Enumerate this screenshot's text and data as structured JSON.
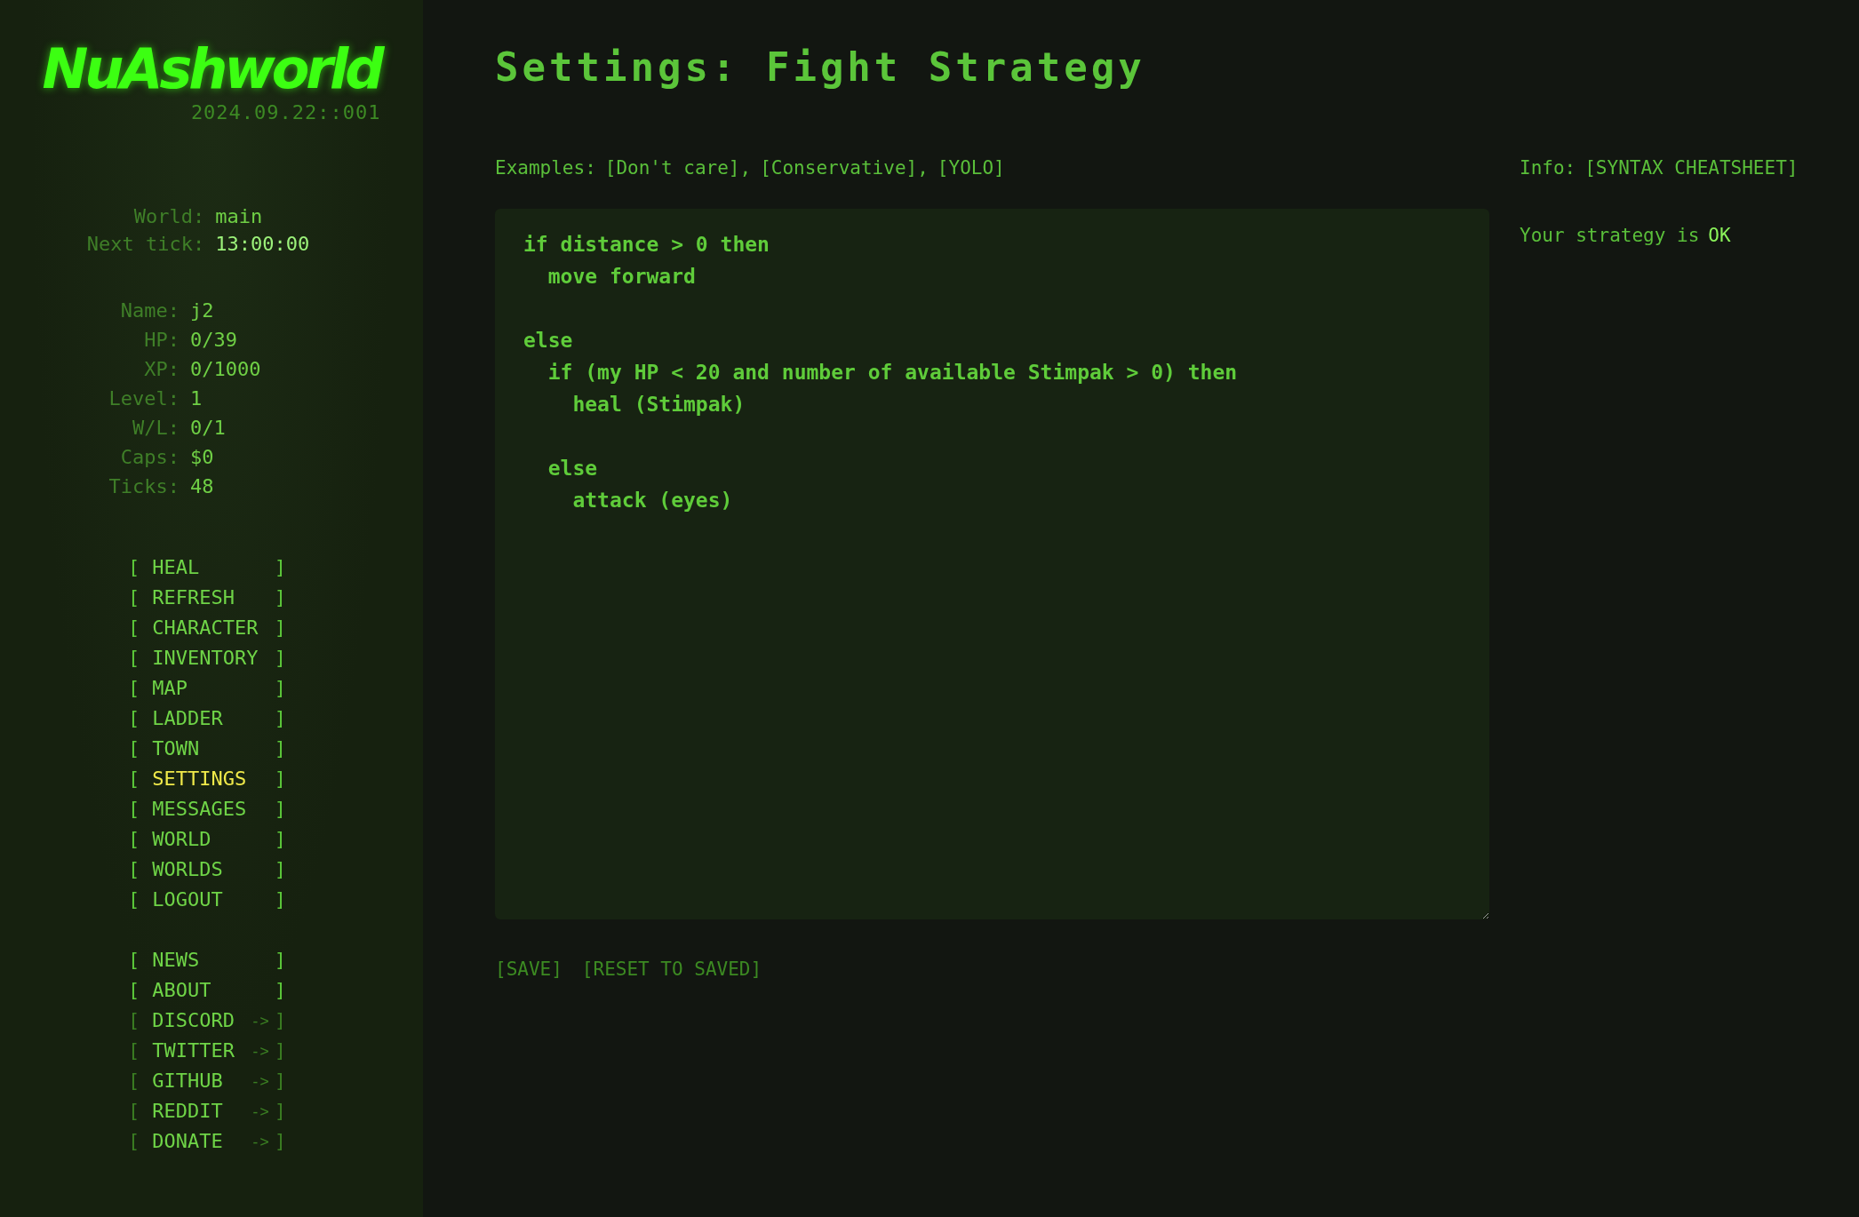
{
  "sidebar": {
    "logo": "NuAshworld",
    "version": "2024.09.22::001",
    "world_info": [
      {
        "label": "World:",
        "value": "main",
        "kind": "plain"
      },
      {
        "label": "Next tick:",
        "value": "13:00:00",
        "kind": "highlight"
      }
    ],
    "stats": [
      {
        "label": "Name:",
        "value": "j2"
      },
      {
        "label": "HP:",
        "value": "0/39"
      },
      {
        "label": "XP:",
        "value": "0/1000"
      },
      {
        "label": "Level:",
        "value": "1"
      },
      {
        "label": "W/L:",
        "value": "0/1"
      },
      {
        "label": "Caps:",
        "value": "$0"
      },
      {
        "label": "Ticks:",
        "value": "48"
      }
    ],
    "menu_groups": [
      [
        {
          "open": "[",
          "label": "HEAL",
          "close": "]",
          "selected": false,
          "kind": "internal"
        },
        {
          "open": "[",
          "label": "REFRESH",
          "close": "]",
          "selected": false,
          "kind": "internal"
        },
        {
          "open": "[",
          "label": "CHARACTER",
          "close": "]",
          "selected": false,
          "kind": "internal"
        },
        {
          "open": "[",
          "label": "INVENTORY",
          "close": "]",
          "selected": false,
          "kind": "internal"
        },
        {
          "open": "[",
          "label": "MAP",
          "close": "]",
          "selected": false,
          "kind": "internal"
        },
        {
          "open": "[",
          "label": "LADDER",
          "close": "]",
          "selected": false,
          "kind": "internal"
        },
        {
          "open": "[",
          "label": "TOWN",
          "close": "]",
          "selected": false,
          "kind": "internal"
        },
        {
          "open": "[",
          "label": "SETTINGS",
          "close": "]",
          "selected": true,
          "kind": "internal"
        },
        {
          "open": "[",
          "label": "MESSAGES",
          "close": "]",
          "selected": false,
          "kind": "internal"
        },
        {
          "open": "[",
          "label": "WORLD",
          "close": "]",
          "selected": false,
          "kind": "internal"
        },
        {
          "open": "[",
          "label": "WORLDS",
          "close": "]",
          "selected": false,
          "kind": "internal"
        },
        {
          "open": "[",
          "label": "LOGOUT",
          "close": "]",
          "selected": false,
          "kind": "internal"
        }
      ],
      [
        {
          "open": "[",
          "label": "NEWS",
          "close": "]",
          "selected": false,
          "kind": "internal"
        },
        {
          "open": "[",
          "label": "ABOUT",
          "close": "]",
          "selected": false,
          "kind": "internal"
        },
        {
          "open": "[",
          "label": "DISCORD",
          "arrow": "->",
          "close": "]",
          "selected": false,
          "kind": "external"
        },
        {
          "open": "[",
          "label": "TWITTER",
          "arrow": "->",
          "close": "]",
          "selected": false,
          "kind": "external"
        },
        {
          "open": "[",
          "label": "GITHUB",
          "arrow": "->",
          "close": "]",
          "selected": false,
          "kind": "external"
        },
        {
          "open": "[",
          "label": "REDDIT",
          "arrow": "->",
          "close": "]",
          "selected": false,
          "kind": "external"
        },
        {
          "open": "[",
          "label": "DONATE",
          "arrow": "->",
          "close": "]",
          "selected": false,
          "kind": "external"
        }
      ]
    ]
  },
  "page_title": "Settings: Fight Strategy",
  "examples": {
    "label": "Examples:",
    "links": [
      "[Don't care]",
      "[Conservative]",
      "[YOLO]"
    ],
    "separator": ","
  },
  "info": {
    "label": "Info:",
    "link": "[SYNTAX CHEATSHEET]"
  },
  "status": {
    "text": "Your strategy is",
    "value": "OK"
  },
  "editor": {
    "value": "if distance > 0 then\n  move forward\n\nelse\n  if (my HP < 20 and number of available Stimpak > 0) then\n    heal (Stimpak)\n\n  else\n    attack (eyes)"
  },
  "actions": [
    "[SAVE]",
    "[RESET TO SAVED]"
  ]
}
